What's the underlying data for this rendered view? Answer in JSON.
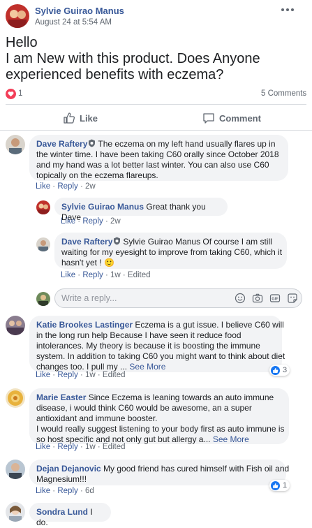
{
  "post": {
    "author": "Sylvie Guirao Manus",
    "timestamp": "August 24 at 5:54 AM",
    "text_line1": "Hello",
    "text_line2": "I am New with this product. Does Anyone",
    "text_line3": "experienced benefits with eczema?",
    "reaction_count": "1",
    "comments_count": "5 Comments",
    "like_label": "Like",
    "comment_label": "Comment"
  },
  "comments": [
    {
      "author": "Dave Raftery",
      "lines": [
        "The eczema on my left hand usually flares up in",
        "the winter time. I have been taking C60 orally since October 2018",
        "and my hand was a lot better last winter. You can also use C60",
        "topically on the eczema flareups."
      ],
      "like": "Like",
      "reply": "Reply",
      "time": "2w"
    },
    {
      "author": "Sylvie Guirao Manus",
      "text": "Great thank you Dave",
      "like": "Like",
      "reply": "Reply",
      "time": "2w"
    },
    {
      "author": "Dave Raftery",
      "lines": [
        "Sylvie Guirao Manus Of course I am still",
        "waiting for my eyesight to improve from taking C60, which it",
        "hasn't yet ! 🙂"
      ],
      "like": "Like",
      "reply": "Reply",
      "time": "1w",
      "edited": "Edited"
    },
    {
      "author": "Katie Brookes Lastinger",
      "lines": [
        "Eczema is a gut issue. I believe C60 will",
        "in the long run help Because I have seen it reduce food",
        "intolerances. My theory is because it is boosting the immune",
        "system. In addition to taking C60 you might want to think about diet",
        "changes too. I pull my ..."
      ],
      "see_more": "See More",
      "reactions": "3",
      "like": "Like",
      "reply": "Reply",
      "time": "1w",
      "edited": "Edited"
    },
    {
      "author": "Marie Easter",
      "lines": [
        "Since Eczema is leaning towards an auto immune",
        "disease, i would think C60 would be awesome, an a super",
        "antioxidant and immune booster.",
        "I would really suggest listening to your body first as auto immune is",
        "so host specific and not only gut but allergy a..."
      ],
      "see_more": "See More",
      "like": "Like",
      "reply": "Reply",
      "time": "1w",
      "edited": "Edited"
    },
    {
      "author": "Dejan Dejanovic",
      "lines": [
        "My good friend has cured himself with Fish oil and",
        "Magnesium!!!"
      ],
      "reactions": "1",
      "like": "Like",
      "reply": "Reply",
      "time": "6d"
    },
    {
      "author": "Sondra Lund",
      "text": "I do."
    }
  ],
  "reply_box": {
    "placeholder": "Write a reply..."
  },
  "icons": [
    "more-options-icon",
    "heart-reaction-icon",
    "thumbs-up-icon",
    "comment-icon",
    "shield-icon",
    "emoji-icon",
    "camera-icon",
    "gif-icon",
    "sticker-icon",
    "like-reaction-icon"
  ],
  "colors": {
    "link": "#385898",
    "bubble": "#f2f3f5",
    "like_blue": "#1877f2",
    "love_red": "#f33e58",
    "meta_gray": "#606770"
  }
}
